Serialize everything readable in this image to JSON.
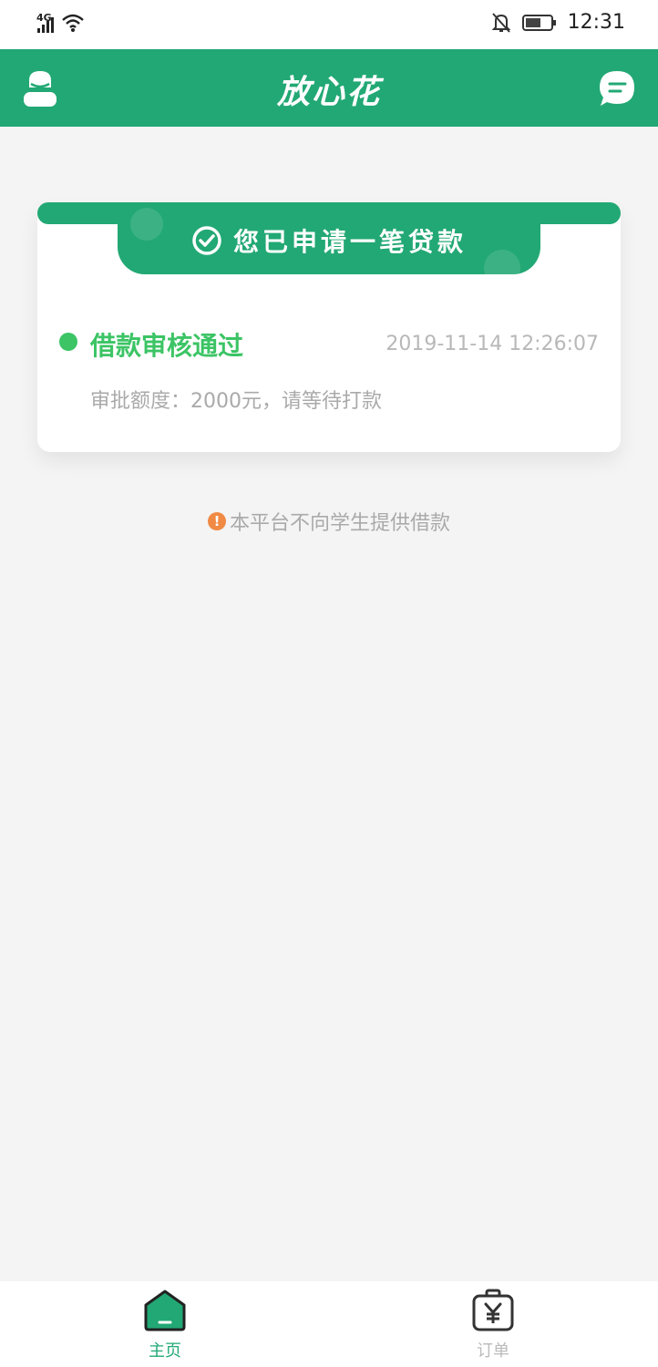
{
  "status_bar": {
    "network": "4G",
    "time": "12:31"
  },
  "header": {
    "title": "放心花",
    "left_icon": "user-icon",
    "right_icon": "message-icon",
    "bar_color": "#22a874"
  },
  "loan_card": {
    "banner_text": "您已申请一笔贷款",
    "status_title": "借款审核通过",
    "status_time": "2019-11-14 12:26:07",
    "status_desc": "审批额度：2000元，请等待打款",
    "status_color": "#3cc465"
  },
  "notice": {
    "text": "本平台不向学生提供借款",
    "icon": "warning-icon"
  },
  "tabbar": {
    "home_label": "主页",
    "orders_label": "订单",
    "active_tab": "主页"
  }
}
